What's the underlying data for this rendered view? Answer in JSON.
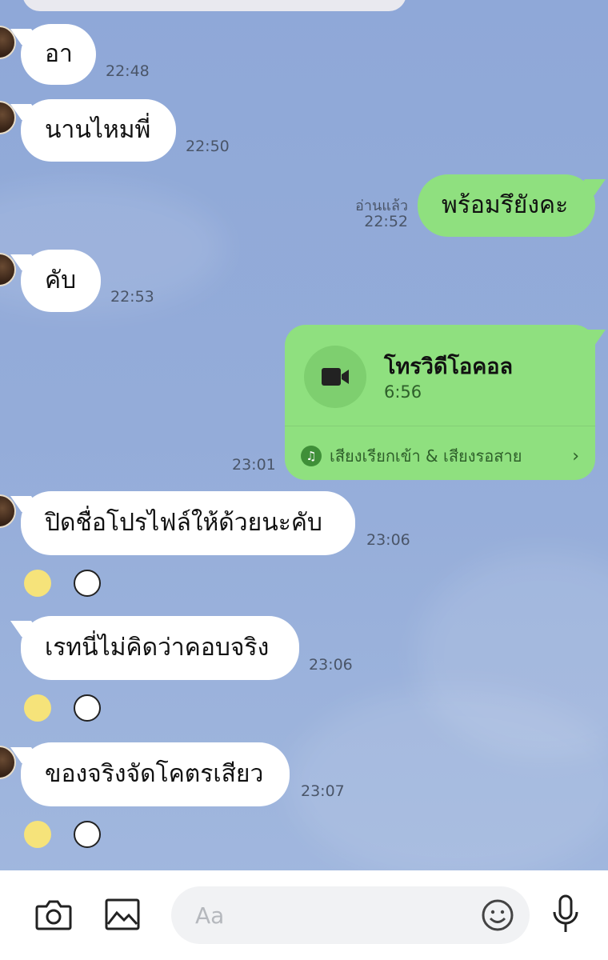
{
  "messages": [
    {
      "text": "อา",
      "time": "22:48"
    },
    {
      "text": "นานไหมพี่",
      "time": "22:50"
    },
    {
      "text": "พร้อมรึยังคะ",
      "time": "22:52",
      "status": "อ่านแล้ว"
    },
    {
      "text": "คับ",
      "time": "22:53"
    },
    {
      "text": "ปิดชื่อโปรไฟล์ให้ด้วยนะคับ",
      "time": "23:06"
    },
    {
      "text": "เรทนี่ไม่คิดว่าคอบจริง",
      "time": "23:06"
    },
    {
      "text": "ของจริงจัดโคตรเสียว",
      "time": "23:07"
    }
  ],
  "call": {
    "title": "โทรวิดีโอคอล",
    "duration": "6:56",
    "footer": "เสียงเรียกเข้า & เสียงรอสาย",
    "time": "23:01"
  },
  "input": {
    "placeholder": "Aa"
  },
  "icons": [
    "camera-icon",
    "image-icon",
    "emoji-icon",
    "microphone-icon",
    "video-camera-icon",
    "music-note-icon",
    "chevron-right-icon"
  ],
  "colors": {
    "background": "#92abd9",
    "incoming_bubble": "#ffffff",
    "outgoing_bubble": "#8fe07f"
  }
}
